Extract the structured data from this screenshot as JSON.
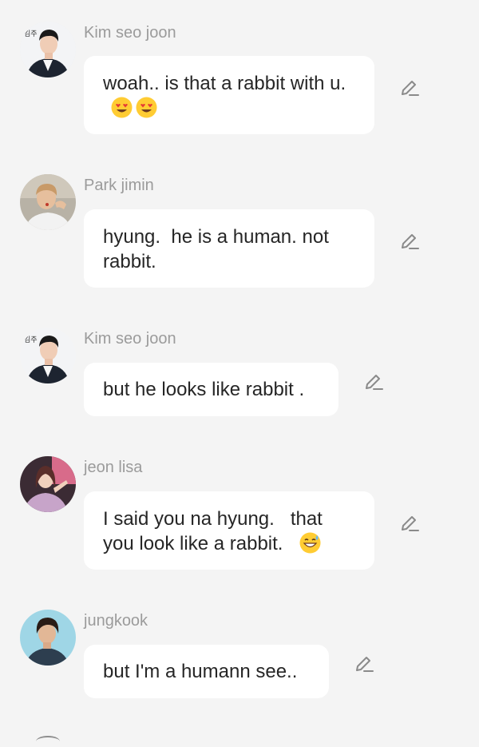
{
  "messages": [
    {
      "sender": "Kim seo joon",
      "text": "woah.. is that a rabbit with u.",
      "emoji": [
        "heart-eyes",
        "heart-eyes"
      ]
    },
    {
      "sender": "Park jimin",
      "text": "hyung.  he is a human. not rabbit."
    },
    {
      "sender": "Kim seo joon",
      "text": "but he looks like rabbit ."
    },
    {
      "sender": "jeon lisa",
      "text": "I said you na hyung.   that you look like a rabbit.",
      "emoji": [
        "grinning-sweat"
      ]
    },
    {
      "sender": "jungkook",
      "text": "but I'm a humann see.."
    }
  ],
  "avatar_thumbnail_text": {
    "ksj": "김주"
  },
  "icons": {
    "edit": "pencil-edit-icon"
  },
  "colors": {
    "background": "#f4f4f4",
    "bubble": "#ffffff",
    "sender_name": "#9b9b9b",
    "message_text": "#262626",
    "icon": "#8a8a8a"
  }
}
